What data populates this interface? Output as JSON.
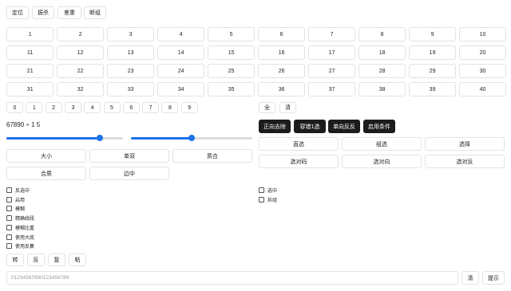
{
  "top_buttons": [
    "定位",
    "振杀",
    "差重",
    "断组"
  ],
  "grid": [
    "1",
    "2",
    "3",
    "4",
    "5",
    "6",
    "7",
    "8",
    "9",
    "10",
    "11",
    "12",
    "13",
    "14",
    "15",
    "16",
    "17",
    "18",
    "19",
    "20",
    "21",
    "22",
    "23",
    "24",
    "25",
    "26",
    "27",
    "28",
    "29",
    "30",
    "31",
    "32",
    "33",
    "34",
    "35",
    "36",
    "37",
    "38",
    "39",
    "40"
  ],
  "digits": [
    "0",
    "1",
    "2",
    "3",
    "4",
    "5",
    "6",
    "7",
    "8",
    "9"
  ],
  "quick": {
    "all": "全",
    "clear": "清"
  },
  "dark_buttons": [
    "正向去除",
    "容错1选",
    "单向反反",
    "启用条件"
  ],
  "value_display": "67890 ÷ 1 5",
  "sliders": [
    {
      "value": 0.8
    },
    {
      "value": 0.5
    }
  ],
  "left_options": [
    "大小",
    "单双",
    "质合",
    "合质",
    "边中"
  ],
  "right_options": [
    "直选",
    "组选",
    "选择",
    "选对码",
    "选对向",
    "选对反"
  ],
  "checks_left": [
    "反选中",
    "启用",
    "模糊",
    "精确线段",
    "模糊比重",
    "使用大底",
    "使用反集"
  ],
  "checks_right": [
    "选中",
    "拆组"
  ],
  "bottom_buttons": [
    "转",
    "反",
    "复",
    "粘"
  ],
  "input": {
    "placeholder": "01234567890123456789"
  },
  "input_actions": {
    "clear": "清",
    "submit": "提示"
  },
  "colors": {
    "accent": "#1a73e8",
    "dark": "#1c1c1c",
    "border": "#e3e3e3"
  }
}
